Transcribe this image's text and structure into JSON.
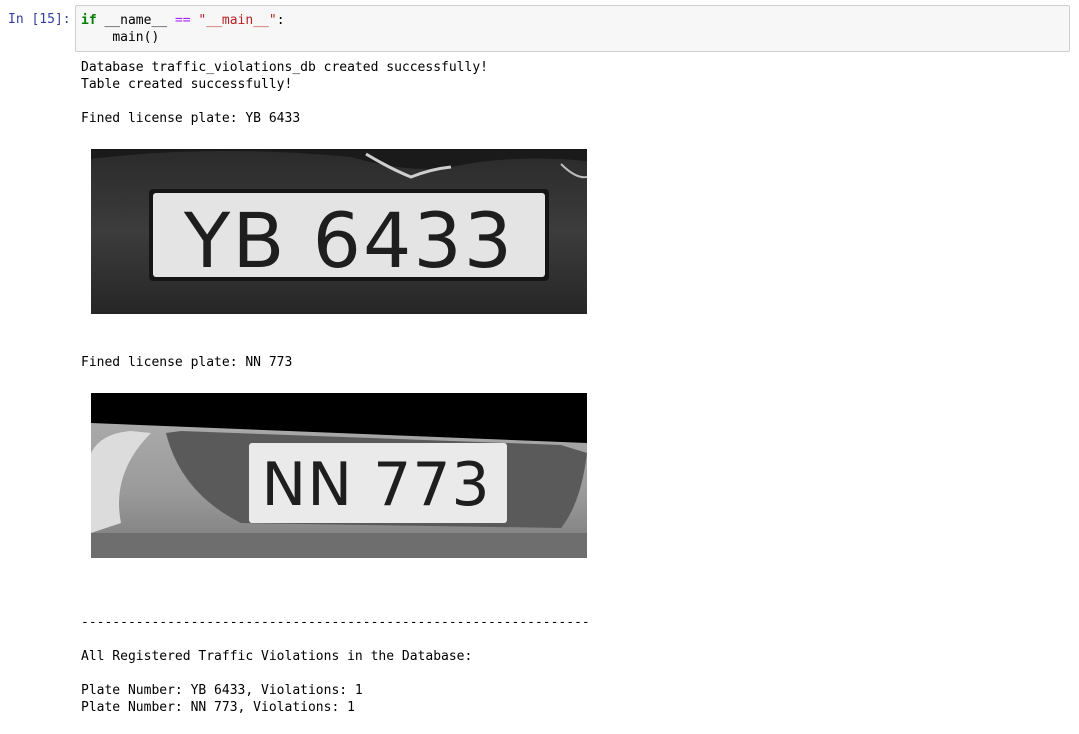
{
  "cell": {
    "prompt": "In [15]:",
    "code": {
      "kw_if": "if",
      "name_var": "__name__",
      "op_eq": "==",
      "main_str": "\"__main__\"",
      "colon": ":",
      "call": "main()"
    }
  },
  "output": {
    "db_created": "Database traffic_violations_db created successfully!",
    "table_created": "Table created successfully!",
    "fined_1": "Fined license plate: YB 6433",
    "plate_1_text": "YB 6433",
    "fined_2": "Fined license plate: NN 773",
    "plate_2_text": "NN 773",
    "separator": "-----------------------------------------------------------------",
    "summary_header": "All Registered Traffic Violations in the Database:",
    "records": [
      "Plate Number: YB 6433, Violations: 1",
      "Plate Number: NN 773, Violations: 1"
    ]
  }
}
